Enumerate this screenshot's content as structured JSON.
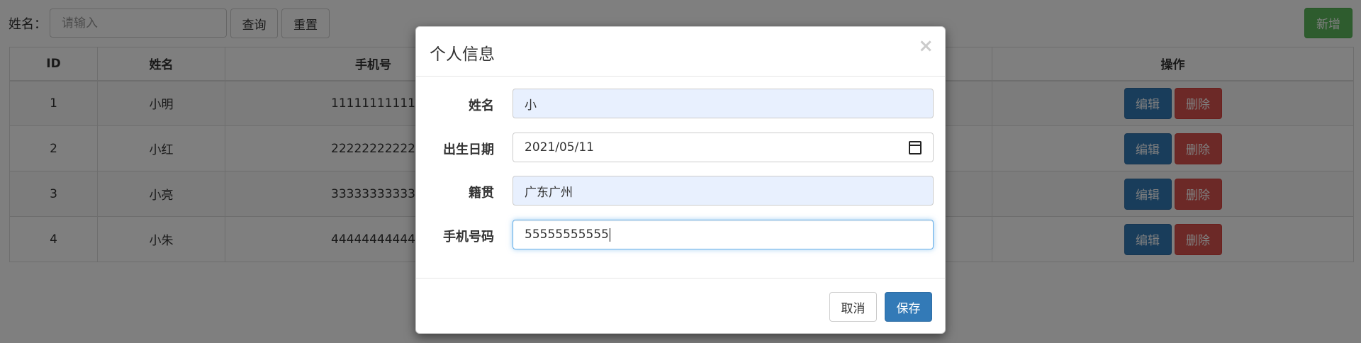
{
  "toolbar": {
    "search_label": "姓名：",
    "search_placeholder": "请输入",
    "query_label": "查询",
    "reset_label": "重置",
    "add_label": "新增"
  },
  "table": {
    "headers": {
      "id": "ID",
      "name": "姓名",
      "phone": "手机号",
      "ops": "操作"
    },
    "rows": [
      {
        "id": "1",
        "name": "小明",
        "phone": "11111111111"
      },
      {
        "id": "2",
        "name": "小红",
        "phone": "22222222222"
      },
      {
        "id": "3",
        "name": "小亮",
        "phone": "33333333333"
      },
      {
        "id": "4",
        "name": "小朱",
        "phone": "44444444444"
      }
    ],
    "edit_label": "编辑",
    "delete_label": "删除"
  },
  "modal": {
    "title": "个人信息",
    "close_glyph": "×",
    "fields": {
      "name_label": "姓名",
      "name_value": "小",
      "birth_label": "出生日期",
      "birth_value": "2021/05/11",
      "native_label": "籍贯",
      "native_value": "广东广州",
      "phone_label": "手机号码",
      "phone_value": "55555555555"
    },
    "cancel_label": "取消",
    "save_label": "保存"
  },
  "colors": {
    "primary": "#337ab7",
    "success": "#5cb85c",
    "danger": "#d9534f",
    "autofill": "#e8f0fe",
    "focus": "#66afe9"
  }
}
